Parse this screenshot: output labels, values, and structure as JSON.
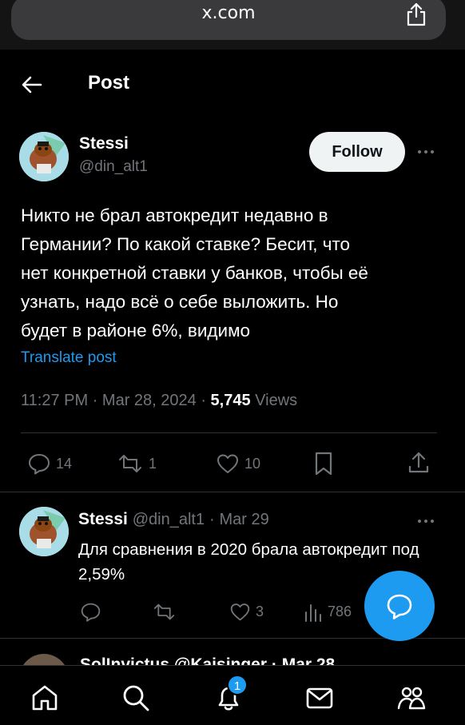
{
  "browser": {
    "url": "x.com"
  },
  "header": {
    "title": "Post"
  },
  "post": {
    "author_name": "Stessi",
    "handle": "@din_alt1",
    "follow_label": "Follow",
    "text": "Никто не брал автокредит недавно в\nГермании? По какой ставке? Бесит, что\nнет конкретной ставки у банков, чтобы её\nузнать, надо всё о себе выложить. Но\nбудет в районе 6%, видимо",
    "translate_label": "Translate post",
    "time": "11:27 PM",
    "date": "Mar 28, 2024",
    "views_count": "5,745",
    "views_label": "Views",
    "replies": "14",
    "reposts": "1",
    "likes": "10"
  },
  "reply": {
    "author_name": "Stessi",
    "handle": "@din_alt1",
    "date": "Mar 29",
    "text": "Для сравнения в 2020 брала автокредит под 2,59%",
    "replies": "",
    "reposts": "",
    "likes": "3",
    "views": "786"
  },
  "peek": {
    "text": "SolInvictus  @Kaisinger · Mar 28"
  },
  "nav": {
    "notifications_badge": "1"
  },
  "colors": {
    "accent": "#1d9bf0",
    "background": "#000000",
    "muted": "#71767b"
  }
}
